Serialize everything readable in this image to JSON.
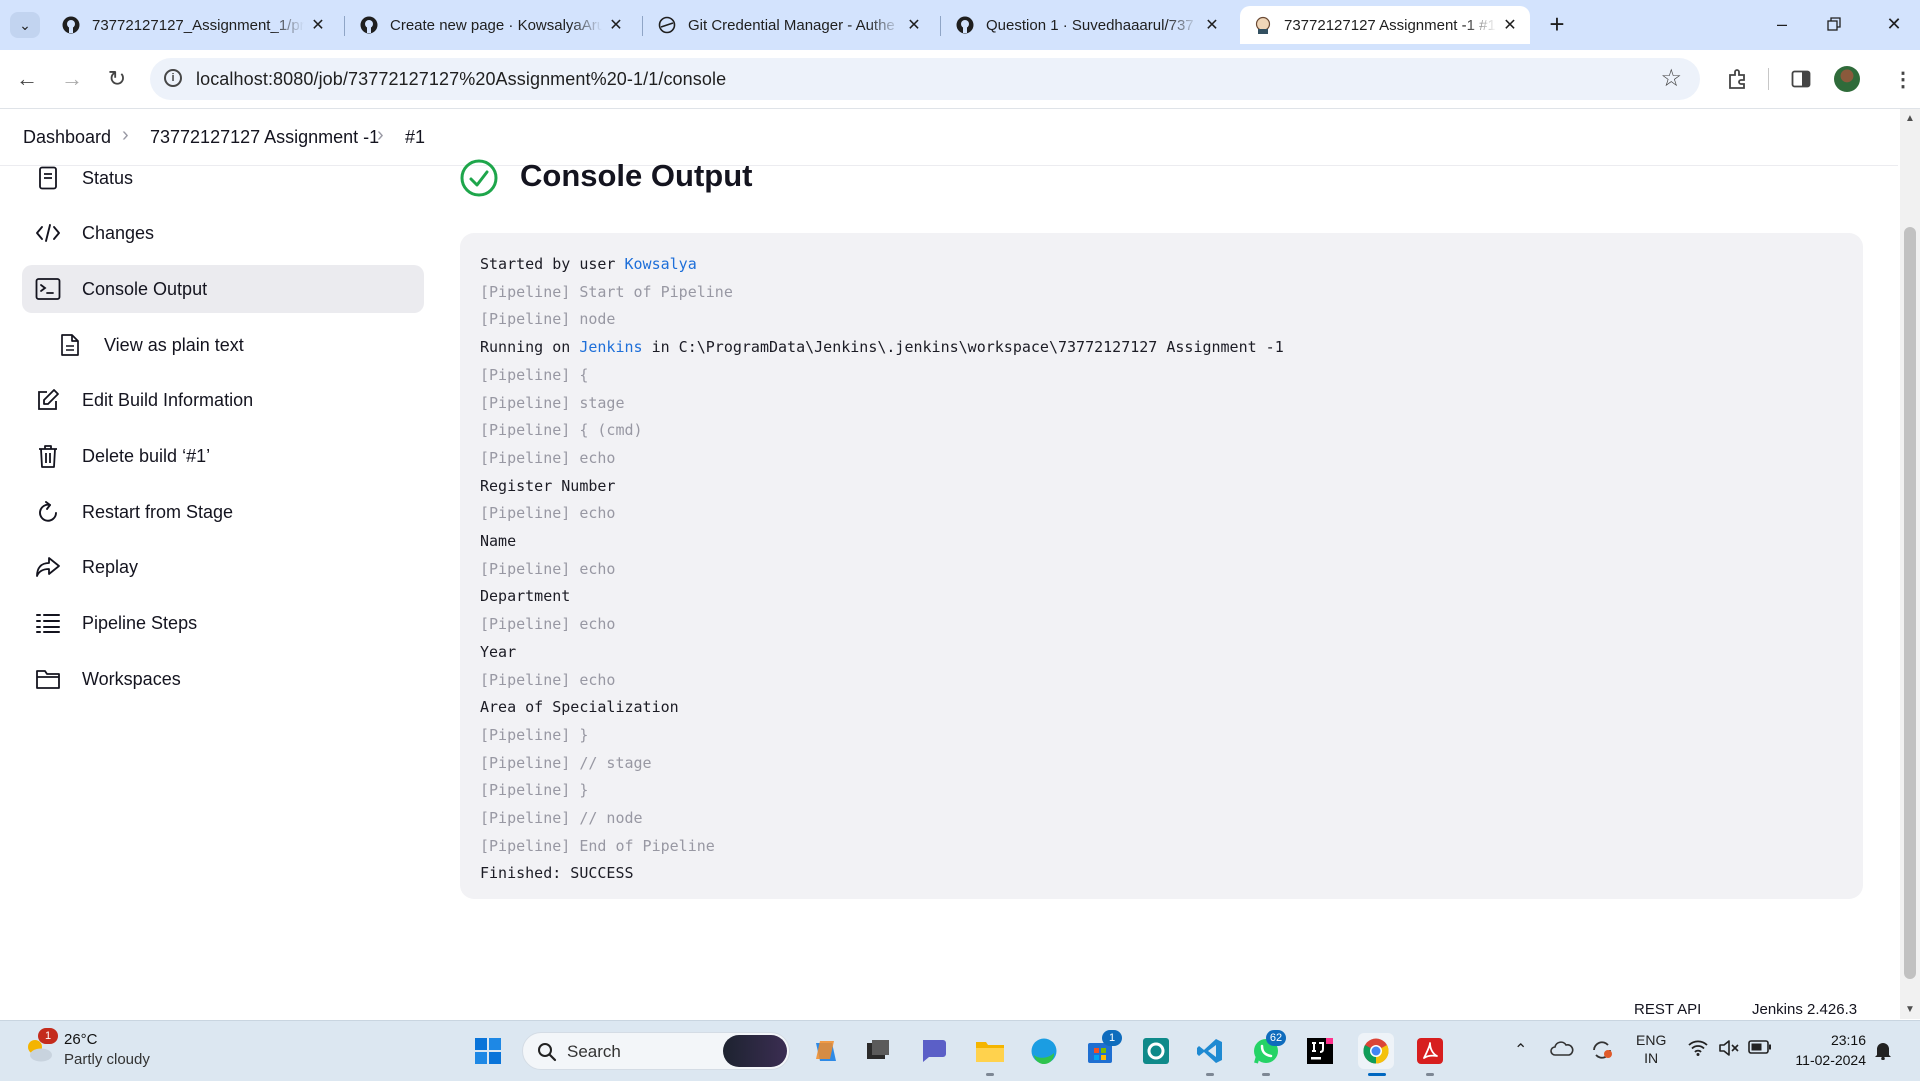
{
  "browser": {
    "tabs": [
      {
        "title": "73772127127_Assignment_1/pr",
        "active": false
      },
      {
        "title": "Create new page · KowsalyaAru",
        "active": false
      },
      {
        "title": "Git Credential Manager - Authe",
        "active": false
      },
      {
        "title": "Question 1 · Suvedhaaarul/737",
        "active": false
      },
      {
        "title": "73772127127 Assignment -1 #1",
        "active": true
      }
    ],
    "address": "localhost:8080/job/73772127127%20Assignment%20-1/1/console"
  },
  "breadcrumb": [
    "Dashboard",
    "73772127127 Assignment -1",
    "#1"
  ],
  "sidebar": {
    "items": [
      {
        "label": "Status",
        "icon": "status-icon"
      },
      {
        "label": "Changes",
        "icon": "code-icon"
      },
      {
        "label": "Console Output",
        "icon": "terminal-icon",
        "active": true
      },
      {
        "label": "View as plain text",
        "icon": "document-icon",
        "sub": true
      },
      {
        "label": "Edit Build Information",
        "icon": "edit-icon"
      },
      {
        "label": "Delete build ‘#1’",
        "icon": "trash-icon"
      },
      {
        "label": "Restart from Stage",
        "icon": "restart-icon"
      },
      {
        "label": "Replay",
        "icon": "replay-icon"
      },
      {
        "label": "Pipeline Steps",
        "icon": "list-icon"
      },
      {
        "label": "Workspaces",
        "icon": "folder-icon"
      }
    ]
  },
  "main": {
    "title": "Console Output",
    "status_color": "#1ea64b",
    "console": {
      "started_prefix": "Started by user ",
      "started_user": "Kowsalya",
      "running_prefix": "Running on ",
      "running_node": "Jenkins",
      "running_suffix": " in C:\\ProgramData\\Jenkins\\.jenkins\\workspace\\73772127127 Assignment -1",
      "lines": [
        "[Pipeline] Start of Pipeline",
        "[Pipeline] node",
        "[Pipeline] {",
        "[Pipeline] stage",
        "[Pipeline] { (cmd)",
        "[Pipeline] echo",
        "Register Number",
        "[Pipeline] echo",
        "Name",
        "[Pipeline] echo",
        "Department",
        "[Pipeline] echo",
        "Year",
        "[Pipeline] echo",
        "Area of Specialization",
        "[Pipeline] }",
        "[Pipeline] // stage",
        "[Pipeline] }",
        "[Pipeline] // node",
        "[Pipeline] End of Pipeline",
        "Finished: SUCCESS"
      ]
    }
  },
  "footer": {
    "rest_api": "REST API",
    "version": "Jenkins 2.426.3"
  },
  "taskbar": {
    "weather": {
      "temp": "26°C",
      "condition": "Partly cloudy",
      "badge": "1"
    },
    "search_label": "Search",
    "badges": {
      "store": "1",
      "whatsapp": "62"
    },
    "lang": {
      "line1": "ENG",
      "line2": "IN"
    },
    "time": "23:16",
    "date": "11-02-2024"
  }
}
